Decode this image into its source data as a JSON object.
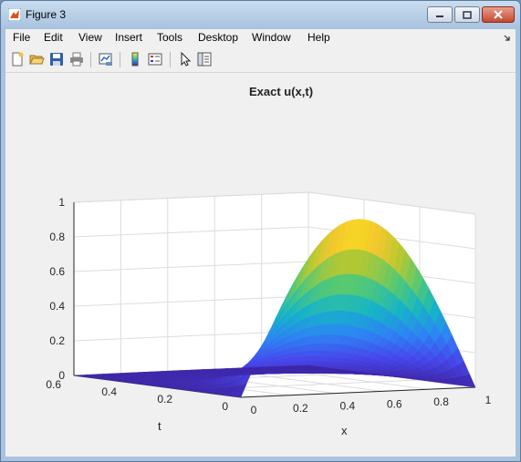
{
  "window": {
    "title": "Figure 3"
  },
  "menu": [
    "File",
    "Edit",
    "View",
    "Insert",
    "Tools",
    "Desktop",
    "Window",
    "Help"
  ],
  "toolbar_icons": [
    "new-figure-icon",
    "open-icon",
    "save-icon",
    "print-icon",
    "link-plot-icon",
    "insert-colorbar-icon",
    "insert-legend-icon",
    "edit-plot-icon",
    "property-inspector-icon"
  ],
  "chart_data": {
    "type": "surface",
    "title": "Exact u(x,t)",
    "xlabel": "x",
    "ylabel": "t",
    "zlabel": "",
    "xlim": [
      0,
      1
    ],
    "ylim": [
      0,
      0.6
    ],
    "zlim": [
      0,
      1
    ],
    "x_ticks": [
      "0",
      "0.2",
      "0.4",
      "0.6",
      "0.8",
      "1"
    ],
    "y_ticks": [
      "0",
      "0.2",
      "0.4",
      "0.6"
    ],
    "z_ticks": [
      "0",
      "0.2",
      "0.4",
      "0.6",
      "0.8",
      "1"
    ],
    "grid": true,
    "colormap": "parula",
    "shape": "sine hump in x, peak 1 at t=0, x=0.5; decays to ~0 by t≈0.3",
    "x": [
      0,
      0.1,
      0.2,
      0.3,
      0.4,
      0.5,
      0.6,
      0.7,
      0.8,
      0.9,
      1.0
    ],
    "t": [
      0,
      0.05,
      0.1,
      0.15,
      0.2,
      0.25,
      0.3,
      0.4,
      0.5,
      0.6
    ],
    "colors": {
      "low": "#3e26a8",
      "mid": "#2db8c8",
      "high": "#f9fb0e"
    }
  }
}
